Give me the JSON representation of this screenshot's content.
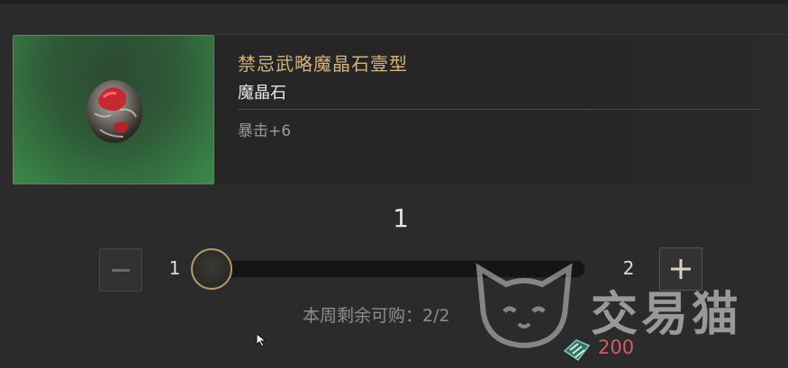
{
  "item": {
    "name": "禁忌武略魔晶石壹型",
    "type": "魔晶石",
    "stat": "暴击+6",
    "icon": "magic-crystal-icon"
  },
  "quantity": {
    "current": "1",
    "min_label": "1",
    "max_label": "2",
    "slider_fraction": 0,
    "minus_icon": "minus-icon",
    "plus_icon": "plus-icon"
  },
  "purchase": {
    "remain_text": "本周剩余可购：2/2",
    "price": "200",
    "currency_icon": "currency-icon",
    "price_color": "#d65a63"
  },
  "watermark": {
    "text": "交易猫",
    "logo_icon": "cat-logo-icon"
  }
}
